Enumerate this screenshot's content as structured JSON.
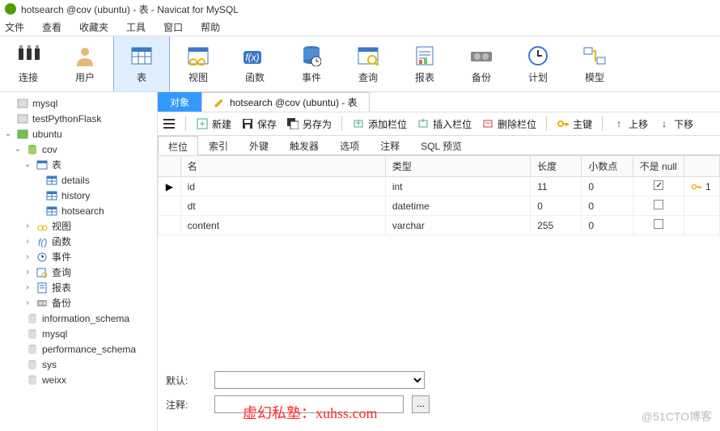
{
  "title": "hotsearch @cov (ubuntu) - 表 - Navicat for MySQL",
  "menu": {
    "file": "文件",
    "view": "查看",
    "fav": "收藏夹",
    "tools": "工具",
    "window": "窗口",
    "help": "帮助"
  },
  "maintoolbar": [
    {
      "id": "connect",
      "label": "连接"
    },
    {
      "id": "user",
      "label": "用户"
    },
    {
      "id": "table",
      "label": "表",
      "active": true
    },
    {
      "id": "view",
      "label": "视图"
    },
    {
      "id": "function",
      "label": "函数"
    },
    {
      "id": "event",
      "label": "事件"
    },
    {
      "id": "query",
      "label": "查询"
    },
    {
      "id": "report",
      "label": "报表"
    },
    {
      "id": "backup",
      "label": "备份"
    },
    {
      "id": "schedule",
      "label": "计划"
    },
    {
      "id": "model",
      "label": "模型"
    }
  ],
  "tree": [
    {
      "lvl": 1,
      "caret": "",
      "icon": "conn-off",
      "label": "mysql"
    },
    {
      "lvl": 1,
      "caret": "",
      "icon": "conn-off",
      "label": "testPythonFlask"
    },
    {
      "lvl": 1,
      "caret": "v",
      "icon": "conn-on",
      "label": "ubuntu"
    },
    {
      "lvl": 2,
      "caret": "v",
      "icon": "db-on",
      "label": "cov"
    },
    {
      "lvl": 3,
      "caret": "v",
      "icon": "tables",
      "label": "表"
    },
    {
      "lvl": 4,
      "caret": "",
      "icon": "table",
      "label": "details"
    },
    {
      "lvl": 4,
      "caret": "",
      "icon": "table",
      "label": "history"
    },
    {
      "lvl": 4,
      "caret": "",
      "icon": "table",
      "label": "hotsearch"
    },
    {
      "lvl": 3,
      "caret": ">",
      "icon": "view",
      "label": "视图"
    },
    {
      "lvl": 3,
      "caret": ">",
      "icon": "func",
      "label": "函数"
    },
    {
      "lvl": 3,
      "caret": ">",
      "icon": "event",
      "label": "事件"
    },
    {
      "lvl": 3,
      "caret": ">",
      "icon": "query",
      "label": "查询"
    },
    {
      "lvl": 3,
      "caret": ">",
      "icon": "report",
      "label": "报表"
    },
    {
      "lvl": 3,
      "caret": ">",
      "icon": "backup",
      "label": "备份"
    },
    {
      "lvl": 2,
      "caret": "",
      "icon": "db-off",
      "label": "information_schema"
    },
    {
      "lvl": 2,
      "caret": "",
      "icon": "db-off",
      "label": "mysql"
    },
    {
      "lvl": 2,
      "caret": "",
      "icon": "db-off",
      "label": "performance_schema"
    },
    {
      "lvl": 2,
      "caret": "",
      "icon": "db-off",
      "label": "sys"
    },
    {
      "lvl": 2,
      "caret": "",
      "icon": "db-off",
      "label": "weixx"
    }
  ],
  "tabs": {
    "objects": "对象",
    "designer": "hotsearch @cov (ubuntu) - 表"
  },
  "actionbar": {
    "new": "新建",
    "save": "保存",
    "saveas": "另存为",
    "addfield": "添加栏位",
    "insertfield": "插入栏位",
    "delfield": "删除栏位",
    "pk": "主键",
    "up": "上移",
    "down": "下移"
  },
  "subtabs": [
    "栏位",
    "索引",
    "外键",
    "触发器",
    "选项",
    "注释",
    "SQL 预览"
  ],
  "grid": {
    "headers": {
      "name": "名",
      "type": "类型",
      "length": "长度",
      "decimals": "小数点",
      "notnull": "不是 null",
      "key": ""
    },
    "rows": [
      {
        "current": true,
        "name": "id",
        "type": "int",
        "length": "11",
        "decimals": "0",
        "notnull": true,
        "key": "1"
      },
      {
        "current": false,
        "name": "dt",
        "type": "datetime",
        "length": "0",
        "decimals": "0",
        "notnull": false,
        "key": ""
      },
      {
        "current": false,
        "name": "content",
        "type": "varchar",
        "length": "255",
        "decimals": "0",
        "notnull": false,
        "key": ""
      }
    ]
  },
  "bottom": {
    "default_label": "默认:",
    "comment_label": "注释:"
  },
  "watermark1": "虚幻私塾：xuhss.com",
  "watermark2": "@51CTO博客"
}
